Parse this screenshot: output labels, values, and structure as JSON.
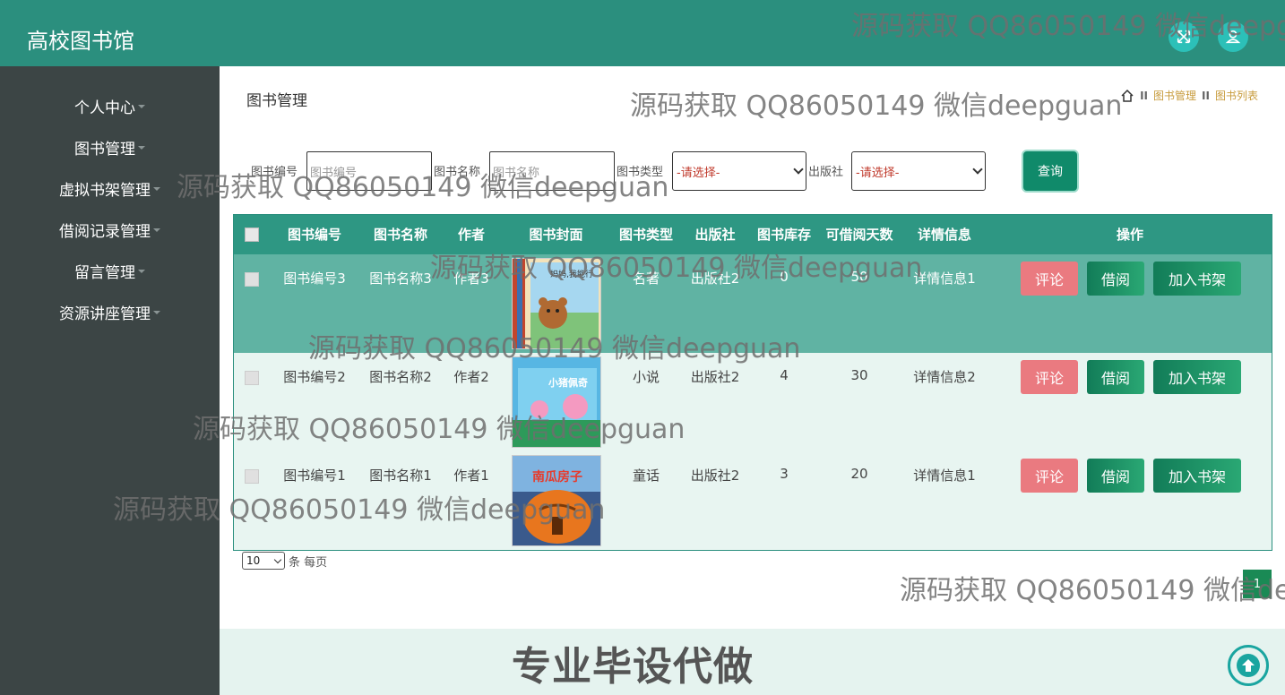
{
  "header": {
    "app_title": "高校图书馆"
  },
  "sidebar": {
    "items": [
      {
        "label": "个人中心"
      },
      {
        "label": "图书管理"
      },
      {
        "label": "虚拟书架管理"
      },
      {
        "label": "借阅记录管理"
      },
      {
        "label": "留言管理"
      },
      {
        "label": "资源讲座管理"
      }
    ]
  },
  "page": {
    "title": "图书管理",
    "breadcrumb": {
      "sep": "II",
      "item1": "图书管理",
      "item2": "图书列表"
    }
  },
  "search": {
    "book_no_label": "图书编号",
    "book_no_placeholder": "图书编号",
    "book_name_label": "图书名称",
    "book_name_placeholder": "图书名称",
    "book_type_label": "图书类型",
    "book_type_value": "-请选择-",
    "publisher_label": "出版社",
    "publisher_value": "-请选择-",
    "query_label": "查询"
  },
  "table": {
    "columns": [
      "图书编号",
      "图书名称",
      "作者",
      "图书封面",
      "图书类型",
      "出版社",
      "图书库存",
      "可借阅天数",
      "详情信息",
      "操作"
    ],
    "rows": [
      {
        "no": "图书编号3",
        "name": "图书名称3",
        "author": "作者3",
        "type": "名著",
        "publisher": "出版社2",
        "stock": "0",
        "days": "50",
        "detail": "详情信息1",
        "cover_text": "妈妈,我能行"
      },
      {
        "no": "图书编号2",
        "name": "图书名称2",
        "author": "作者2",
        "type": "小说",
        "publisher": "出版社2",
        "stock": "4",
        "days": "30",
        "detail": "详情信息2",
        "cover_text": "小猪佩奇"
      },
      {
        "no": "图书编号1",
        "name": "图书名称1",
        "author": "作者1",
        "type": "童话",
        "publisher": "出版社2",
        "stock": "3",
        "days": "20",
        "detail": "详情信息1",
        "cover_text": "南瓜房子"
      }
    ],
    "actions": {
      "comment": "评论",
      "borrow": "借阅",
      "add_shelf": "加入书架"
    }
  },
  "pagination": {
    "per_page": "10",
    "per_page_suffix": "条 每页",
    "current_page": "1"
  },
  "footer": {
    "promo": "专业毕设代做"
  },
  "watermark": "源码获取 QQ86050149 微信deepguan",
  "watermark_cut": "源码获取 QQ86050149 微信deepgu",
  "watermark_cut2": "源码获取 QQ86050149 微信dee",
  "colors": {
    "header": "#2b8f7e",
    "sidebar": "#3c4545",
    "accent": "#108a6a",
    "comment": "#ea7a80"
  },
  "icons": [
    "expand-icon",
    "user-icon",
    "home-icon",
    "arrow-up-icon"
  ]
}
